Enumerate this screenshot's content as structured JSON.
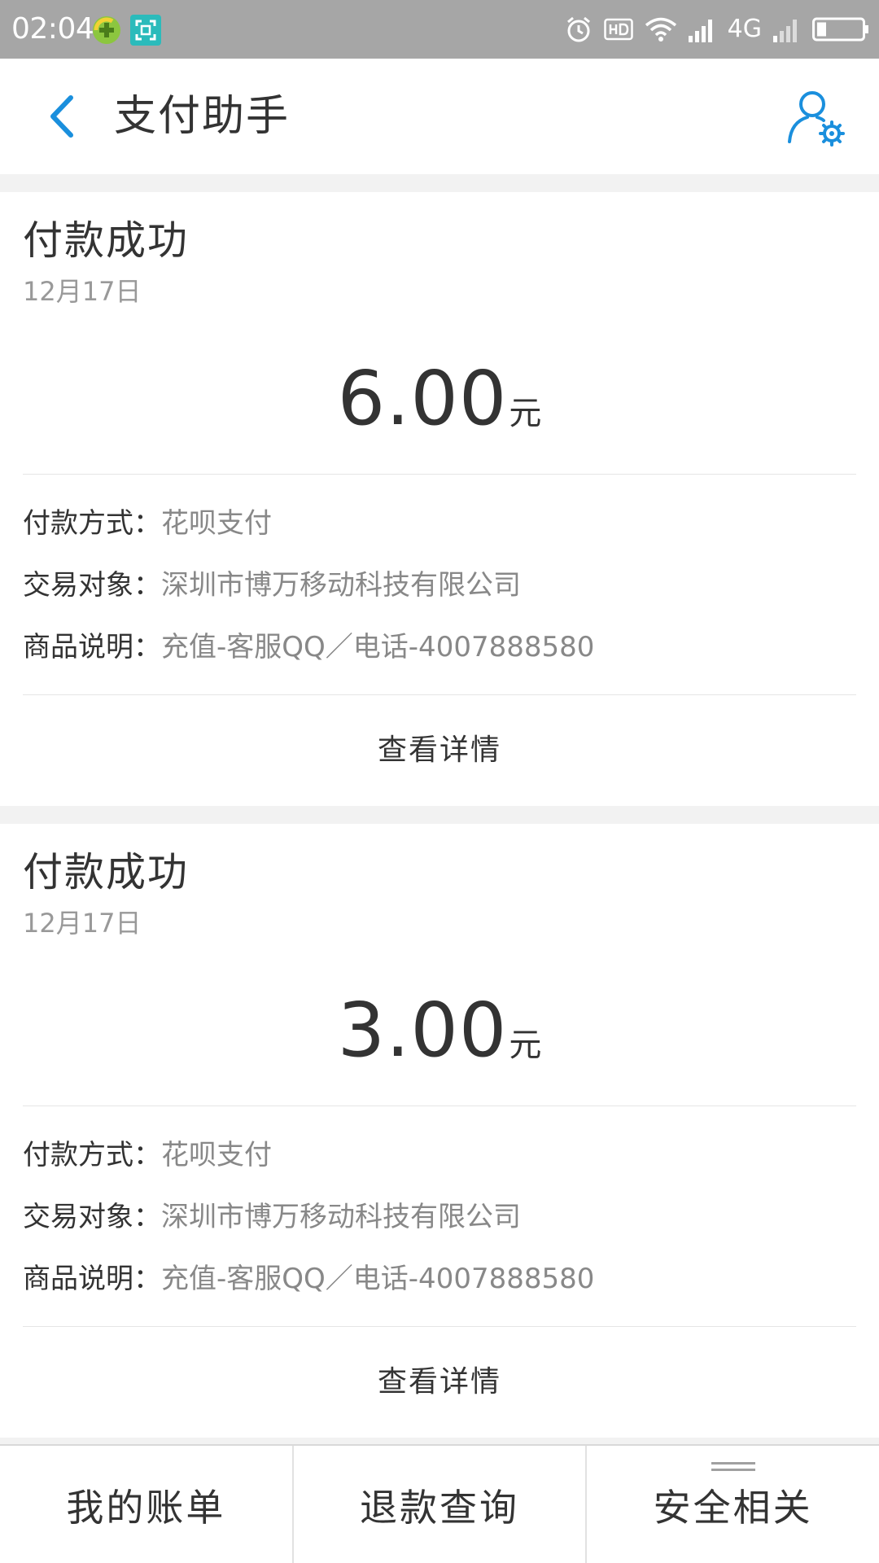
{
  "status_bar": {
    "time": "02:04",
    "network": "4G",
    "icons": [
      "green-plus-app-icon",
      "scanner-app-icon",
      "alarm-icon",
      "hd-icon",
      "wifi-icon",
      "cellular-signal-icon",
      "cellular-signal-icon",
      "battery-icon"
    ],
    "colors": {
      "background": "#a6a6a6",
      "icon": "#ffffff",
      "app_green": "#8cc63f",
      "app_teal": "#2bbbbb"
    }
  },
  "navbar": {
    "title": "支付助手",
    "back_icon": "chevron-left-icon",
    "settings_icon": "user-settings-icon",
    "accent_color": "#1a8fdd"
  },
  "cards": [
    {
      "status": "付款成功",
      "date": "12月17日",
      "amount": "6.00",
      "unit": "元",
      "details": [
        {
          "label": "付款方式：",
          "value": "花呗支付"
        },
        {
          "label": "交易对象：",
          "value": "深圳市博万移动科技有限公司"
        },
        {
          "label": "商品说明：",
          "value": "充值-客服QQ／电话-4007888580"
        }
      ],
      "action_label": "查看详情"
    },
    {
      "status": "付款成功",
      "date": "12月17日",
      "amount": "3.00",
      "unit": "元",
      "details": [
        {
          "label": "付款方式：",
          "value": "花呗支付"
        },
        {
          "label": "交易对象：",
          "value": "深圳市博万移动科技有限公司"
        },
        {
          "label": "商品说明：",
          "value": "充值-客服QQ／电话-4007888580"
        }
      ],
      "action_label": "查看详情"
    }
  ],
  "tabbar": {
    "tabs": [
      {
        "label": "我的账单"
      },
      {
        "label": "退款查询"
      },
      {
        "label": "安全相关",
        "icon": "menu-lines-icon"
      }
    ]
  }
}
